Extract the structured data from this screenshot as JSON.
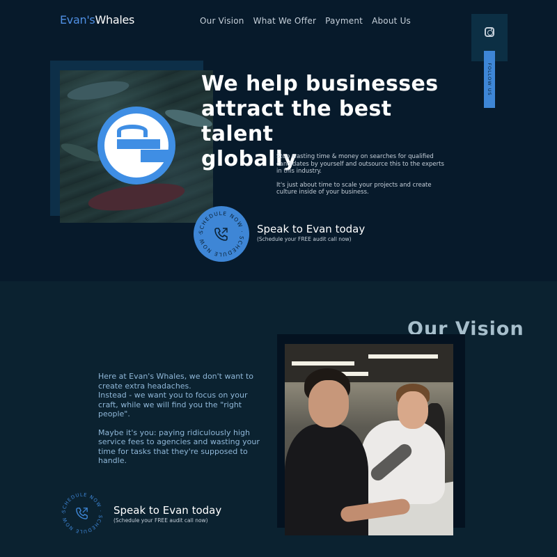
{
  "header": {
    "logo_part1": "Evan's",
    "logo_part2": "Whales",
    "nav": [
      "Our Vision",
      "What We Offer",
      "Payment",
      "About Us"
    ],
    "social": {
      "icon": "instagram-icon",
      "follow_label": "FOLLOW US"
    }
  },
  "hero": {
    "title": "We help businesses\nattract the best talent\nglobally",
    "desc_p1": "Stop wasting time & money on searches for qualified candidates by yourself and outsource this to the experts in this industry.",
    "desc_p2": "It's just about time to scale your projects and create culture inside of your business.",
    "stamp_text": "SCHEDULE NOW · SCHEDULE NOW ·",
    "cta_title": "Speak to Evan today",
    "cta_sub": "(Schedule your FREE audit call now)"
  },
  "vision": {
    "title": "Our Vision",
    "p1": "Here at Evan's Whales, we don't want to create extra headaches.\nInstead - we want you to focus on your craft, while we will find you the \"right people\".",
    "p2": "Maybe it's you: paying ridiculously high service fees to agencies and wasting your time for tasks that they're supposed to handle.",
    "cta_title": "Speak to Evan today",
    "cta_sub": "(Schedule your FREE audit call now)"
  },
  "colors": {
    "background_top": "#071a2b",
    "background_bottom": "#0b2230",
    "accent_blue": "#3e86d6",
    "text_light_blue": "#8fb7d8"
  }
}
